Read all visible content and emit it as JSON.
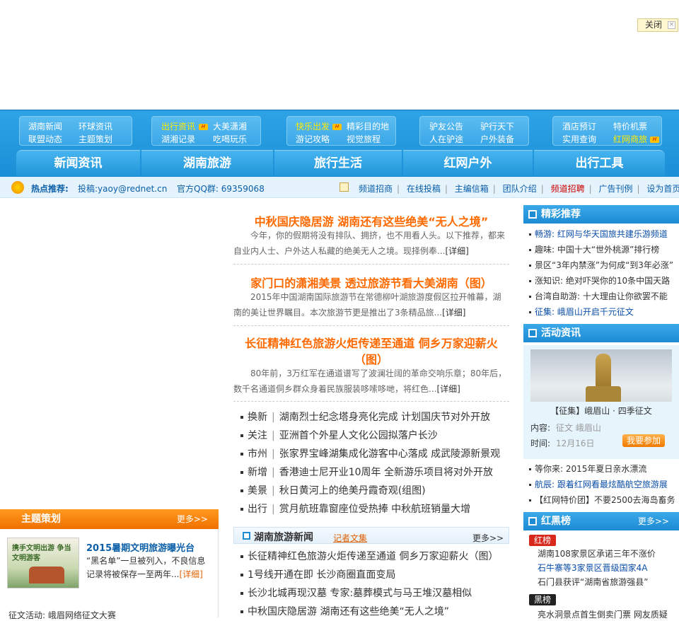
{
  "top": {
    "close_label": "关闭"
  },
  "nav_groups": [
    {
      "r1": [
        "湖南新闻",
        "环球资讯"
      ],
      "r2": [
        "联盟动态",
        "主题策划"
      ]
    },
    {
      "r1": [
        "出行资讯",
        "大美潇湘"
      ],
      "r2": [
        "湖湘记录",
        "吃喝玩乐"
      ]
    },
    {
      "r1": [
        "快乐出发",
        "精彩目的地"
      ],
      "r2": [
        "游记攻略",
        "视觉旅程"
      ]
    },
    {
      "r1": [
        "驴友公告",
        "驴行天下"
      ],
      "r2": [
        "人在驴途",
        "户外装备"
      ]
    },
    {
      "r1": [
        "酒店预订",
        "特价机票"
      ],
      "r2": [
        "实用查询",
        "红网商旅"
      ]
    }
  ],
  "main_tabs": [
    "新闻资讯",
    "湖南旅游",
    "旅行生活",
    "红网户外",
    "出行工具"
  ],
  "hotbar": {
    "label": "热点推荐:",
    "submit": "投稿:yaoy@rednet.cn",
    "qq": "官方QQ群: 69359068",
    "links": [
      "频道招商",
      "在线投稿",
      "主编信箱",
      "团队介绍",
      "频道招聘",
      "广告刊例",
      "设为首页"
    ]
  },
  "headlines": [
    {
      "title": "中秋国庆隐居游 湖南还有这些绝美“无人之境”",
      "summary": "今年，你的假期将没有排队、拥挤，也不用看人头。以下推荐，都来自业内人士、户外达人私藏的绝美无人之境。现择例奉...",
      "detail": "[详细]"
    },
    {
      "title": "家门口的潇湘美景 透过旅游节看大美湖南（图）",
      "summary": "2015年中国湖南国际旅游节在常德柳叶湖旅游度假区拉开帷幕，湖南的美让世界瞩目。本次旅游节更是推出了3条精品旅...",
      "detail": "[详细]"
    },
    {
      "title": "长征精神红色旅游火炬传递至通道 侗乡万家迎薪火（图）",
      "summary": "80年前，3万红军在通道谱写了波澜壮阔的革命交响乐章；80年后，数千名通道侗乡群众身着民族服装哆嗦哆哋，将红色...",
      "detail": "[详细]"
    }
  ],
  "news_list": [
    {
      "cat": "换新",
      "text": "湖南烈士纪念塔身亮化完成 计划国庆节对外开放"
    },
    {
      "cat": "关注",
      "text": "亚洲首个外星人文化公园拟落户长沙"
    },
    {
      "cat": "市州",
      "text": "张家界宝峰湖集成化游客中心落成 成武陵源新景观"
    },
    {
      "cat": "新增",
      "text": "香港迪士尼开业10周年 全新游乐项目将对外开放"
    },
    {
      "cat": "美景",
      "text": "秋日黄河上的绝美丹霞奇观(组图)"
    },
    {
      "cat": "出行",
      "text": "赏月航班靠窗座位受热捧 中秋航班销量大增"
    }
  ],
  "hunan_news": {
    "tab": "湖南旅游新闻",
    "tab2": "记者文集",
    "more": "更多>>",
    "items": [
      "长征精神红色旅游火炬传递至通道 侗乡万家迎薪火（图）",
      "1号线开通在即 长沙商圈直面变局",
      "长沙北城再现汉墓 专家:墓葬模式与马王堆汉墓相似",
      "中秋国庆隐居游 湖南还有这些绝美“无人之境”"
    ]
  },
  "theme": {
    "title": "主题策划",
    "more": "更多>>",
    "headline": "2015暑期文明旅游曝光台",
    "text": "“黑名单”一旦被列入，不良信息记录将被保存一至两年...",
    "detail": "[详细]",
    "img_text": "携手文明出游 争当文明游客",
    "bottom": "征文活动: 峨眉网络征文大赛"
  },
  "side": {
    "featured": {
      "title": "精彩推荐",
      "items": [
        "畅游: 红网与华天国旅共建乐游频道",
        "趣味: 中国十大“世外桃源”排行榜",
        "景区“3年内禁涨”为何成“到3年必涨”",
        "涨知识: 绝对吓哭你的10条中国天路",
        "台湾自助游: 十大理由让你欲罢不能",
        "征集: 峨眉山开启千元征文"
      ]
    },
    "activity": {
      "title": "活动资讯",
      "caption": "【征集】峨眉山 · 四季征文",
      "content_label": "内容:",
      "content_value": "征文 峨眉山",
      "time_label": "时间:",
      "time_value": "12月16日",
      "join": "我要参加",
      "items": [
        "等你来: 2015年夏日亲水漂流",
        "航辰: 跟着红网看最炫酷航空旅游展",
        "【红网特价团】不要2500去海岛畜务"
      ]
    },
    "redblack": {
      "title": "红黑榜",
      "more": "更多>>",
      "red_tag": "红榜",
      "red_items": [
        "湖南108家景区承诺三年不涨价",
        "石牛寨等3家景区晋级国家4A",
        "石门县获评“湖南省旅游强县”"
      ],
      "black_tag": "黑榜",
      "black_items": [
        "亮水洞景点首生倒卖门票 网友质疑"
      ]
    }
  }
}
